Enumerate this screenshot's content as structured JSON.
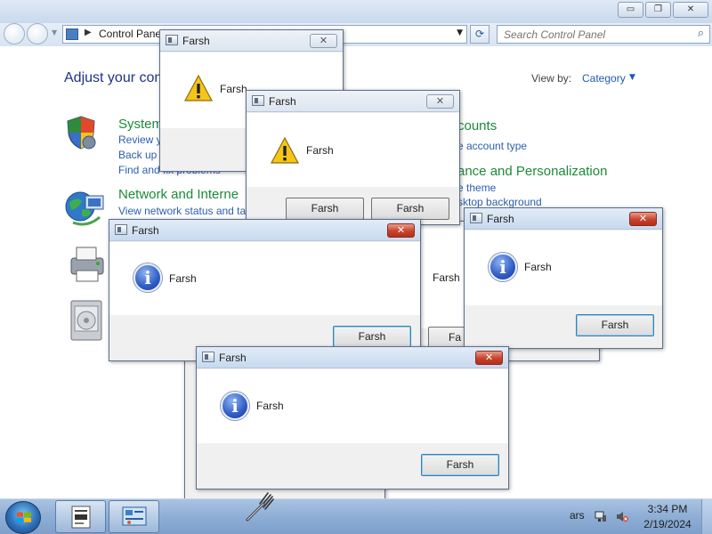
{
  "window": {
    "caption_buttons": {
      "minimize": "▭",
      "maximize": "❐",
      "close": "✕"
    }
  },
  "address": {
    "breadcrumb": "Control Pane",
    "search_placeholder": "Search Control Panel"
  },
  "control_panel": {
    "title": "Adjust your con",
    "view_by_label": "View by:",
    "view_by_value": "Category",
    "categories": [
      {
        "heading": "System",
        "links": [
          "Review y",
          "Back up",
          "Find and fix problems"
        ]
      },
      {
        "heading": "Network and Interne",
        "links": [
          "View network status and tas"
        ]
      }
    ],
    "right_fragments": {
      "accounts": "counts",
      "account_type": "e account type",
      "appearance": "ance and Personalization",
      "theme": "e theme",
      "background": "sktop background"
    },
    "behind_fragments": {
      "msg": "Farsh",
      "btn": "Fa"
    }
  },
  "dialogs": [
    {
      "id": "d1",
      "title": "Farsh",
      "message": "Farsh",
      "icon": "warning-icon",
      "buttons": []
    },
    {
      "id": "d2",
      "title": "Farsh",
      "message": "Farsh",
      "icon": "warning-icon",
      "buttons": [
        "Farsh",
        "Farsh"
      ]
    },
    {
      "id": "d3",
      "title": "Farsh",
      "message": "Farsh",
      "icon": "info-icon",
      "buttons": [
        "Farsh"
      ]
    },
    {
      "id": "d4",
      "title": "Farsh",
      "message": "Farsh",
      "icon": "info-icon",
      "buttons": [
        "Farsh"
      ]
    },
    {
      "id": "d5",
      "title": "Farsh",
      "message": "Farsh",
      "icon": "info-icon",
      "buttons": [
        "Farsh"
      ]
    }
  ],
  "taskbar": {
    "tray_text": "ars",
    "time": "3:34 PM",
    "date": "2/19/2024",
    "pinned": [
      "notepad-icon",
      "control-panel-icon"
    ]
  },
  "colors": {
    "category_heading": "#1d8a3a",
    "link": "#2a5fb0",
    "title_text": "#1e3287",
    "close_red": "#c6422b"
  }
}
